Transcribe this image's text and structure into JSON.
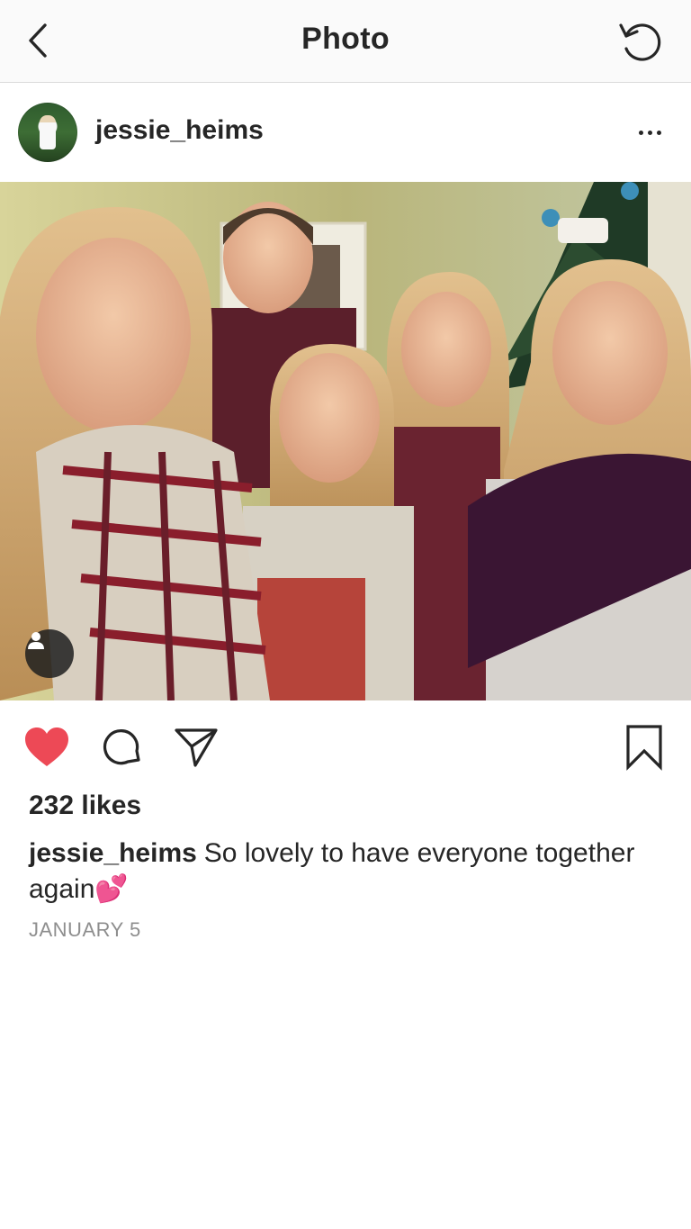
{
  "topbar": {
    "title": "Photo",
    "back_icon": "chevron-left-icon",
    "refresh_icon": "refresh-icon"
  },
  "post": {
    "username": "jessie_heims",
    "more_icon": "more-horizontal-icon",
    "image_alt": "Group selfie of five people in front of a Christmas tree",
    "tag_icon": "user-tag-icon"
  },
  "actions": {
    "like_icon": "heart-filled-icon",
    "comment_icon": "comment-icon",
    "share_icon": "send-icon",
    "save_icon": "bookmark-icon",
    "like_color": "#ed4956"
  },
  "engagement": {
    "likes": "232 likes"
  },
  "caption": {
    "username": "jessie_heims",
    "text": "So lovely to have everyone together again💕"
  },
  "date": "JANUARY 5"
}
